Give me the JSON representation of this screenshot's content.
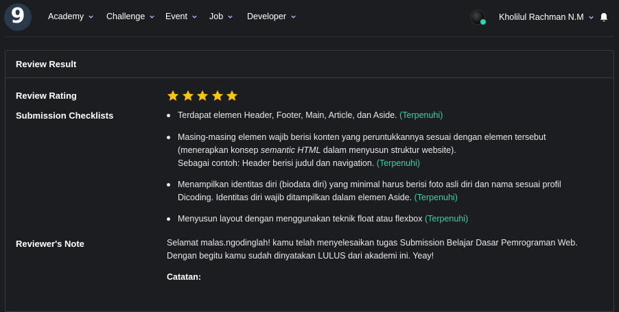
{
  "brand": {
    "logo_glyph": "9",
    "accent_color": "#3fd0a4"
  },
  "nav": {
    "items": [
      {
        "label": "Academy"
      },
      {
        "label": "Challenge"
      },
      {
        "label": "Event"
      },
      {
        "label": "Job"
      },
      {
        "label": "Developer"
      }
    ],
    "user_name": "Kholilul Rachman N.M",
    "icons": {
      "dropdown": "chevron-down-icon",
      "notifications": "bell-icon"
    }
  },
  "review": {
    "card_title": "Review Result",
    "rating_label": "Review Rating",
    "rating": 5,
    "rating_max": 5,
    "checklist_label": "Submission Checklists",
    "checklist": [
      {
        "lines": [
          "Terdapat elemen Header, Footer, Main, Article, dan Aside."
        ],
        "status": "(Terpenuhi)"
      },
      {
        "line1": "Masing-masing elemen wajib berisi konten yang peruntukkannya sesuai dengan elemen tersebut",
        "line2_pre": "(menerapkan konsep ",
        "line2_em": "semantic HTML",
        "line2_post": " dalam menyusun struktur website).",
        "line3": "Sebagai contoh: Header berisi judul dan navigation.",
        "status": "(Terpenuhi)"
      },
      {
        "line1": "Menampilkan identitas diri (biodata diri) yang minimal harus berisi foto asli diri dan nama sesuai profil",
        "line2": "Dicoding. Identitas diri wajib ditampilkan dalam elemen Aside.",
        "status": "(Terpenuhi)"
      },
      {
        "line1": "Menyusun layout dengan menggunakan teknik float atau flexbox",
        "status": "(Terpenuhi)"
      }
    ],
    "note_label": "Reviewer's Note",
    "note_text": "Selamat malas.ngodinglah! kamu telah menyelesaikan tugas Submission Belajar Dasar Pemrograman Web. Dengan begitu kamu sudah dinyatakan LULUS dari akademi ini. Yeay!",
    "note_catatan": "Catatan:"
  }
}
